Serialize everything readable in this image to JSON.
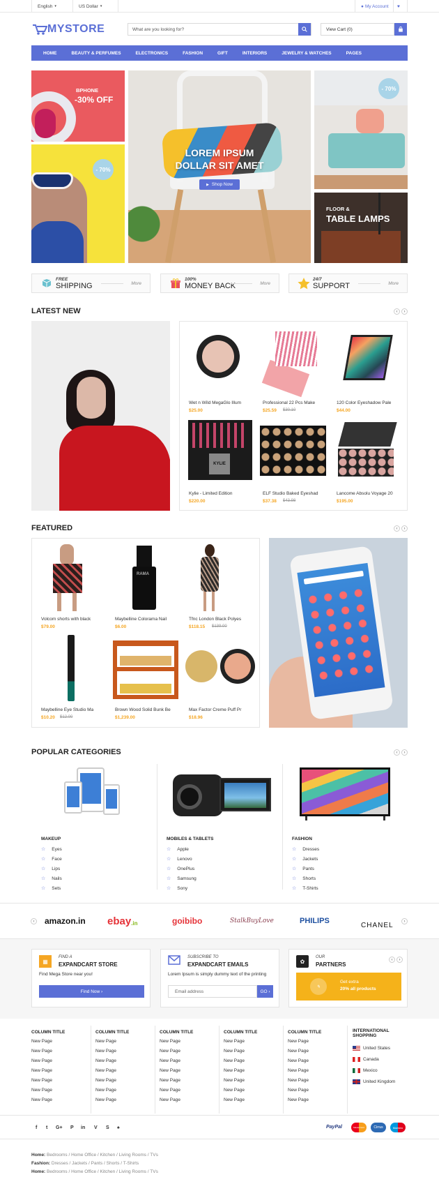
{
  "topbar": {
    "language": "English",
    "currency": "US Dollar",
    "account": "My Account"
  },
  "header": {
    "logo_my": "MY",
    "logo_store": "STORE",
    "search_placeholder": "What are you looking for?",
    "cart": "View Cart (0)"
  },
  "nav": [
    "HOME",
    "BEAUTY & PERFUMES",
    "ELECTRONICS",
    "FASHION",
    "GIFT",
    "INTERIORS",
    "JEWELRY & WATCHES",
    "PAGES"
  ],
  "banners": {
    "bphone_title": "BPHONE",
    "bphone_offer": "-30% OFF",
    "hero_title_1": "LOREM IPSUM",
    "hero_title_2": "DOLLAR SIT AMET",
    "hero_button": "Shop Now",
    "sofa_badge": "- 70%",
    "sunglasses_badge": "- 70%",
    "lamp_small": "FLOOR &",
    "lamp_big": "TABLE LAMPS"
  },
  "services": [
    {
      "small": "FREE",
      "big": "SHIPPING",
      "more": "More"
    },
    {
      "small": "100%",
      "big": "MONEY BACK",
      "more": "More"
    },
    {
      "small": "24/7",
      "big": "SUPPORT",
      "more": "More"
    }
  ],
  "latest": {
    "title": "LATEST NEW",
    "products": [
      {
        "name": "Wet n Wild MegaGlo Illum",
        "price": "$25.00",
        "old": ""
      },
      {
        "name": "Professional 22 Pcs Make",
        "price": "$25.59",
        "old": "$30.10"
      },
      {
        "name": "120 Color Eyeshadow Pale",
        "price": "$44.00",
        "old": ""
      },
      {
        "name": "Kylie - Limited Edition",
        "price": "$220.00",
        "old": ""
      },
      {
        "name": "ELF Studio Baked Eyeshad",
        "price": "$37.38",
        "old": "$43.98"
      },
      {
        "name": "Lancome Absolu Voyage 20",
        "price": "$195.00",
        "old": ""
      }
    ]
  },
  "featured": {
    "title": "FEATURED",
    "products": [
      {
        "name": "Volcom shorts with black",
        "price": "$79.00",
        "old": ""
      },
      {
        "name": "Maybelline Colorama Nail",
        "price": "$6.00",
        "old": ""
      },
      {
        "name": "Tfnc London Black Polyes",
        "price": "$118.15",
        "old": "$139.00"
      },
      {
        "name": "Maybelline Eye Studio Ma",
        "price": "$10.20",
        "old": "$12.00"
      },
      {
        "name": "Brown Wood Solid Bunk Be",
        "price": "$1,239.00",
        "old": ""
      },
      {
        "name": "Max Factor Creme Puff Pr",
        "price": "$18.96",
        "old": ""
      }
    ]
  },
  "categories": {
    "title": "POPULAR CATEGORIES",
    "groups": [
      {
        "name": "MAKEUP",
        "items": [
          "Eyes",
          "Face",
          "Lips",
          "Nails",
          "Sets"
        ]
      },
      {
        "name": "MOBILES & TABLETS",
        "items": [
          "Apple",
          "Lenovo",
          "OnePlus",
          "Samsung",
          "Sony"
        ]
      },
      {
        "name": "FASHION",
        "items": [
          "Dresses",
          "Jackets",
          "Pants",
          "Shorts",
          "T-Shirts"
        ]
      }
    ]
  },
  "brands": [
    "amazon.in",
    "ebay",
    ".in",
    "goibibo",
    "StalkBuyLove",
    "PHILIPS",
    "CHANEL"
  ],
  "info": {
    "store_small": "FIND A",
    "store_title": "EXPANDCART STORE",
    "store_text": "Find Mega Store near you!",
    "store_button": "Find Now ›",
    "email_small": "SUBSCRIBE TO",
    "email_title": "EXPANDCART EMAILS",
    "email_text": "Lorem Ipsum is simply dummy text of the printing",
    "email_placeholder": "Email address",
    "email_button": "GO ›",
    "partners_small": "OUR",
    "partners_title": "PARTNERS",
    "partner_line1": "Get extra",
    "partner_line2": "20% all products"
  },
  "footer": {
    "column_title": "COLUMN TITLE",
    "link": "New Page",
    "intl_title_1": "INTERNATIONAL",
    "intl_title_2": "SHOPPING",
    "countries": [
      "United States",
      "Canada",
      "Mexico",
      "United Kingdom"
    ],
    "social": [
      "f",
      "t",
      "G+",
      "P",
      "in",
      "V",
      "S",
      "♠"
    ],
    "payments": [
      "PayPal",
      "MasterCard",
      "Cirrus",
      "Maestro"
    ],
    "crumbs": [
      {
        "label": "Home:",
        "text": "Bedrooms / Home Office / Kitchen / Living Rooms / TVs"
      },
      {
        "label": "Fashion:",
        "text": "Dresses / Jackets / Pants / Shorts / T-Shirts"
      },
      {
        "label": "Home:",
        "text": "Bedrooms / Home Office / Kitchen / Living Rooms / TVs"
      }
    ]
  },
  "colors": {
    "accent": "#5b6fd6",
    "price": "#f5a623"
  }
}
